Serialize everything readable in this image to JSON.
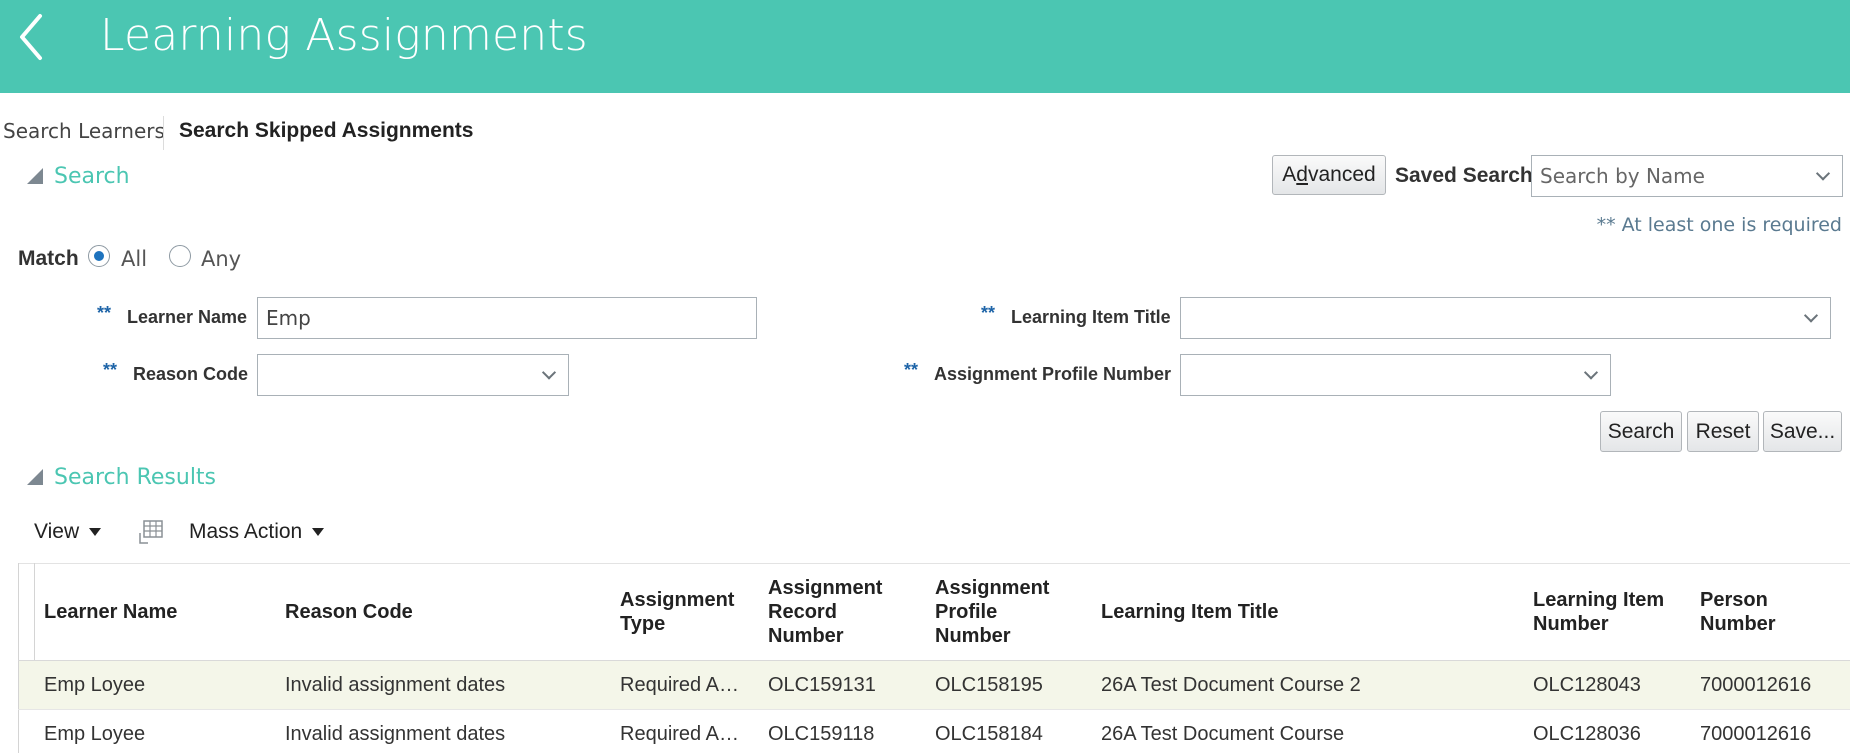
{
  "header": {
    "title": "Learning Assignments",
    "back_icon": "chevron-left-icon"
  },
  "tabs": [
    {
      "label": "Search Learners"
    },
    {
      "label": "Search Skipped Assignments"
    }
  ],
  "search": {
    "title": "Search",
    "advanced_label_pre": "A",
    "advanced_label_u": "d",
    "advanced_label_post": "vanced",
    "saved_search_label": "Saved Search",
    "saved_search_placeholder": "Search by Name",
    "required_note": "** At least one is required",
    "match_label": "Match",
    "match_all": "All",
    "match_any": "Any",
    "fields": {
      "learner_name": {
        "stars": "**",
        "label": "Learner Name",
        "value": "Emp"
      },
      "learning_item_title": {
        "stars": "**",
        "label": "Learning Item Title",
        "value": ""
      },
      "reason_code": {
        "stars": "**",
        "label": "Reason Code",
        "value": ""
      },
      "assignment_profile_number": {
        "stars": "**",
        "label": "Assignment Profile Number",
        "value": ""
      }
    },
    "buttons": {
      "search": "Search",
      "reset": "Reset",
      "save": "Save..."
    }
  },
  "results": {
    "title": "Search Results",
    "view_label": "View",
    "mass_action_label": "Mass Action",
    "columns": [
      {
        "l1": "Learner Name",
        "l2": "",
        "l3": ""
      },
      {
        "l1": "Reason Code",
        "l2": "",
        "l3": ""
      },
      {
        "l1": "Assignment",
        "l2": "Type",
        "l3": ""
      },
      {
        "l1": "Assignment",
        "l2": "Record",
        "l3": "Number"
      },
      {
        "l1": "Assignment",
        "l2": "Profile",
        "l3": "Number"
      },
      {
        "l1": "Learning Item Title",
        "l2": "",
        "l3": ""
      },
      {
        "l1": "Learning Item",
        "l2": "Number",
        "l3": ""
      },
      {
        "l1": "Person",
        "l2": "Number",
        "l3": ""
      }
    ],
    "rows": [
      [
        "Emp Loyee",
        "Invalid assignment dates",
        "Required A…",
        "OLC159131",
        "OLC158195",
        "26A Test Document Course 2",
        "OLC128043",
        "7000012616"
      ],
      [
        "Emp Loyee",
        "Invalid assignment dates",
        "Required A…",
        "OLC159118",
        "OLC158184",
        "26A Test Document Course",
        "OLC128036",
        "7000012616"
      ]
    ]
  }
}
